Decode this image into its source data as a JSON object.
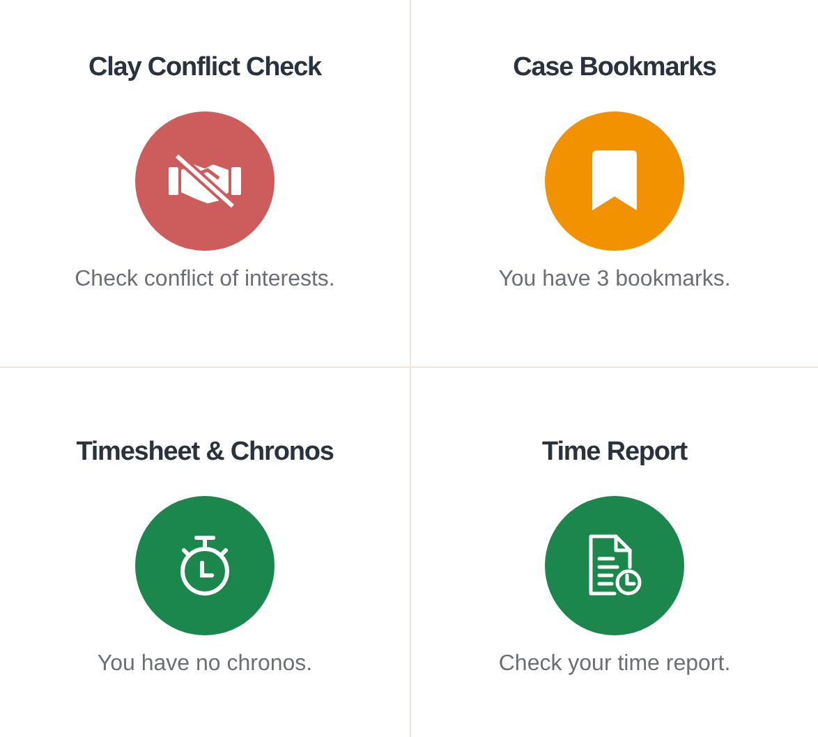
{
  "cards": [
    {
      "title": "Clay Conflict Check",
      "kind": "no-handshake",
      "color": "#cd5c5c",
      "description": "Check conflict of interests."
    },
    {
      "title": "Case Bookmarks",
      "kind": "bookmark",
      "color": "#f39200",
      "description": "You have 3 bookmarks."
    },
    {
      "title": "Timesheet & Chronos",
      "kind": "stopwatch",
      "color": "#1b874c",
      "description": "You have no chronos."
    },
    {
      "title": "Time Report",
      "kind": "report",
      "color": "#1b874c",
      "description": "Check your time report."
    }
  ]
}
